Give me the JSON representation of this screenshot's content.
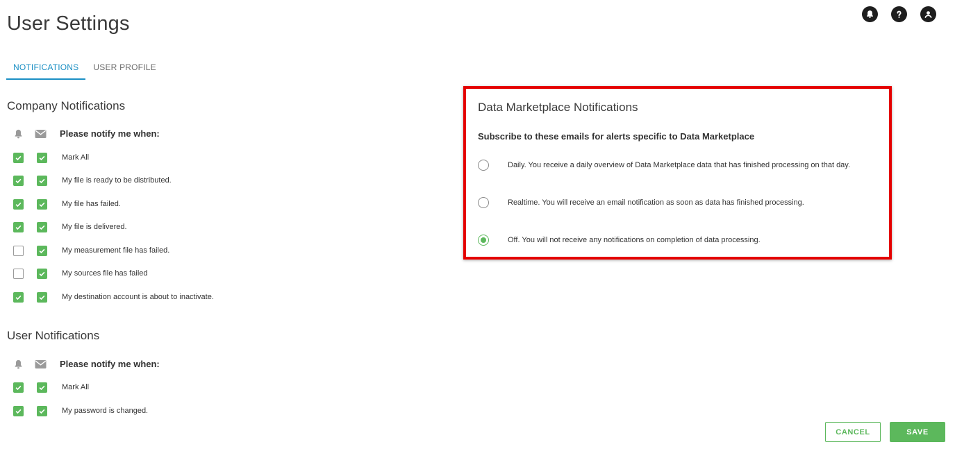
{
  "page": {
    "title": "User Settings"
  },
  "header_icons": [
    "bell-icon",
    "help-icon",
    "account-icon"
  ],
  "tabs": [
    {
      "label": "NOTIFICATIONS",
      "active": true
    },
    {
      "label": "USER PROFILE",
      "active": false
    }
  ],
  "company_notifications": {
    "heading": "Company Notifications",
    "notify_label": "Please notify me when:",
    "rows": [
      {
        "label": "Mark All",
        "app": true,
        "email": true
      },
      {
        "label": "My file is ready to be distributed.",
        "app": true,
        "email": true
      },
      {
        "label": "My file has failed.",
        "app": true,
        "email": true
      },
      {
        "label": "My file is delivered.",
        "app": true,
        "email": true
      },
      {
        "label": "My measurement file has failed.",
        "app": false,
        "email": true
      },
      {
        "label": "My sources file has failed",
        "app": false,
        "email": true
      },
      {
        "label": "My destination account is about to inactivate.",
        "app": true,
        "email": true
      }
    ]
  },
  "user_notifications": {
    "heading": "User Notifications",
    "notify_label": "Please notify me when:",
    "rows": [
      {
        "label": "Mark All",
        "app": true,
        "email": true
      },
      {
        "label": "My password is changed.",
        "app": true,
        "email": true
      }
    ]
  },
  "data_marketplace": {
    "heading": "Data Marketplace Notifications",
    "subtitle": "Subscribe to these emails for alerts specific to Data Marketplace",
    "options": [
      {
        "label": "Daily. You receive a daily overview of Data Marketplace data that has finished processing on that day.",
        "selected": false
      },
      {
        "label": "Realtime. You will receive an email notification as soon as data has finished processing.",
        "selected": false
      },
      {
        "label": "Off. You will not receive any notifications on completion of data processing.",
        "selected": true
      }
    ]
  },
  "buttons": {
    "cancel": "CANCEL",
    "save": "SAVE"
  },
  "colors": {
    "accent_blue": "#1a8fc4",
    "green": "#5cb85c",
    "highlight_red": "#e40000"
  }
}
